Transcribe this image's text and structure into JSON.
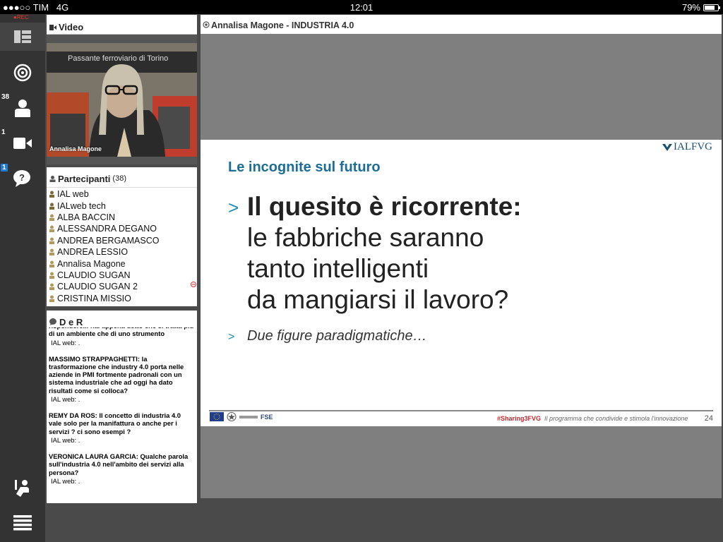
{
  "statusbar": {
    "carrier": "●●●○○ TIM",
    "network": "4G",
    "time": "12:01",
    "battery": "79%"
  },
  "sidebar": {
    "rec": "●REC",
    "participants_count": "38",
    "camera_count": "1",
    "chat_count": "1"
  },
  "video": {
    "title": "Video",
    "name_label": "Annalisa Magone",
    "bg_text": "Passante ferroviario di Torino"
  },
  "participants": {
    "title": "Partecipanti",
    "count": "(38)",
    "list": [
      "IAL web",
      "IALweb tech",
      "ALBA BACCIN",
      "ALESSANDRA DEGANO",
      "ANDREA BERGAMASCO",
      "ANDREA LESSIO",
      "Annalisa Magone",
      "CLAUDIO SUGAN",
      "CLAUDIO SUGAN 2",
      "CRISTINA MISSIO"
    ]
  },
  "qa": {
    "title": "D e R",
    "items": [
      {
        "q": "rispondere... hai appena detto che si tratta più di un ambiente che di uno strumento",
        "a": "IAL web: ."
      },
      {
        "q": "MASSIMO STRAPPAGHETTI: la trasformazione che industry 4.0 porta nelle aziende in PMI fortmente padronali con un sistema industriale che ad oggi ha dato risultati come si colloca?",
        "a": "IAL web: ."
      },
      {
        "q": "REMY DA ROS: Il concetto di industria 4.0 vale solo per la manifattura o anche per i servizi ? ci sono esempi ?",
        "a": "IAL web: ."
      },
      {
        "q": "VERONICA LAURA GARCIA: Qualche parola sull'industria 4.0 nell'ambito dei servizi alla persona?",
        "a": "IAL web: ."
      }
    ]
  },
  "slide_panel": {
    "title": "Annalisa Magone - INDUSTRIA 4.0"
  },
  "slide": {
    "logo": "IALFVG",
    "heading": "Le incognite sul futuro",
    "bullet_marker": ">",
    "main_bold": "Il quesito è ricorrente:",
    "main_lines": [
      "le fabbriche saranno",
      "tanto intelligenti",
      "da mangiarsi il lavoro?"
    ],
    "sub_bullet": "Due figure paradigmatiche…",
    "footer_hashtag": "#Sharing3FVG",
    "footer_tagline": "Il programma che condivide e stimola l'innovazione",
    "footer_logo_fse": "FSE",
    "page_number": "24"
  },
  "colors": {
    "accent": "#1c6e96",
    "hashtag": "#c0282e",
    "rec": "#e03a2a",
    "badge": "#1e7dd8"
  }
}
